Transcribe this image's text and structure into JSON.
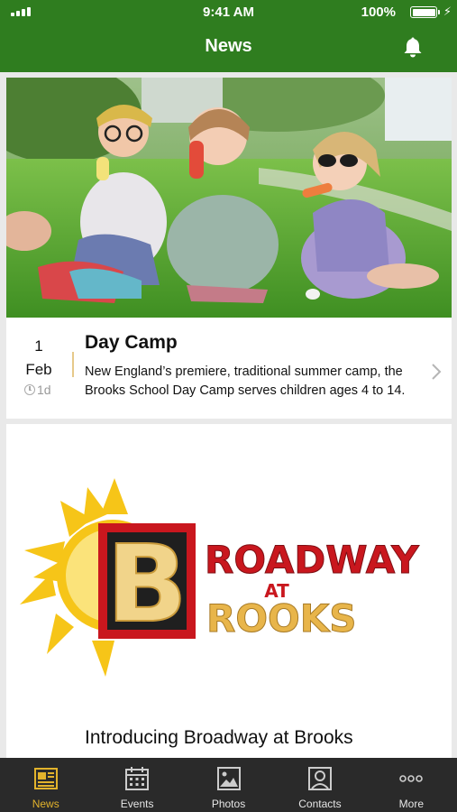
{
  "status_bar": {
    "time": "9:41 AM",
    "battery": "100%"
  },
  "header": {
    "title": "News"
  },
  "feed": [
    {
      "day": "1",
      "month": "Feb",
      "ago": "1d",
      "title": "Day Camp",
      "description": "New England’s premiere, traditional summer camp, the Brooks School Day Camp serves children ages 4 to 14."
    },
    {
      "title": "Introducing Broadway at Brooks",
      "logo": {
        "big_letter": "B",
        "line1": "ROADWAY",
        "at": "AT",
        "line2": "ROOKS"
      }
    }
  ],
  "tabbar": {
    "items": [
      {
        "label": "News",
        "icon": "newspaper-icon",
        "active": true
      },
      {
        "label": "Events",
        "icon": "calendar-icon",
        "active": false
      },
      {
        "label": "Photos",
        "icon": "photo-icon",
        "active": false
      },
      {
        "label": "Contacts",
        "icon": "contact-icon",
        "active": false
      },
      {
        "label": "More",
        "icon": "more-dots-icon",
        "active": false
      }
    ]
  },
  "colors": {
    "header_bg": "#2f7d1f",
    "tabbar_bg": "#2a2a2a",
    "tab_active": "#e2b32c",
    "logo_red": "#c9171e",
    "logo_gold": "#e8b54a",
    "sun": "#f6c518"
  }
}
